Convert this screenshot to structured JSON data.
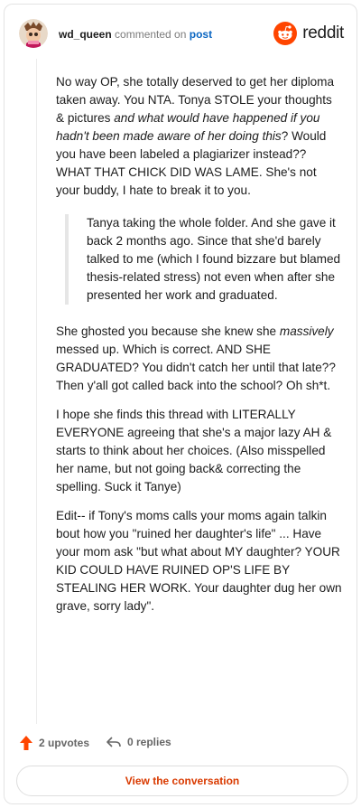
{
  "header": {
    "username": "wd_queen",
    "commented_on": "commented on",
    "post_link": "post",
    "brand": "reddit"
  },
  "comment": {
    "p1_a": "No way OP, she totally deserved to get her diploma taken away. You NTA. Tonya STOLE your thoughts & pictures ",
    "p1_em": "and what would have happened if you hadn't been made aware of her doing this",
    "p1_b": "? Would you have been labeled a plagiarizer instead?? WHAT THAT CHICK DID WAS LAME. She's not your buddy, I hate to break it to you.",
    "quote": "Tanya taking the whole folder. And she gave it back 2 months ago. Since that she'd barely talked to me (which I found bizzare but blamed thesis-related stress) not even when after she presented her work and graduated.",
    "p2_a": "She ghosted you because she knew she ",
    "p2_em": "massively",
    "p2_b": " messed up. Which is correct. AND SHE GRADUATED? You didn't catch her until that late?? Then y'all got called back into the school? Oh sh*t.",
    "p3": "I hope she finds this thread with LITERALLY EVERYONE agreeing that she's a major lazy AH & starts to think about her choices. (Also misspelled her name, but not going back& correcting the spelling. Suck it Tanye)",
    "p4": "Edit-- if Tony's moms calls your moms again talkin bout how you \"ruined her daughter's life\" ... Have your mom ask \"but what about MY daughter? YOUR KID COULD HAVE RUINED OP'S LIFE BY STEALING HER WORK. Your daughter dug her own grave, sorry lady\"."
  },
  "footer": {
    "upvotes": "2 upvotes",
    "replies": "0 replies",
    "view_conversation": "View the conversation"
  },
  "colors": {
    "accent": "#ff4500",
    "link": "#0a66c2",
    "cta": "#d93a00"
  }
}
